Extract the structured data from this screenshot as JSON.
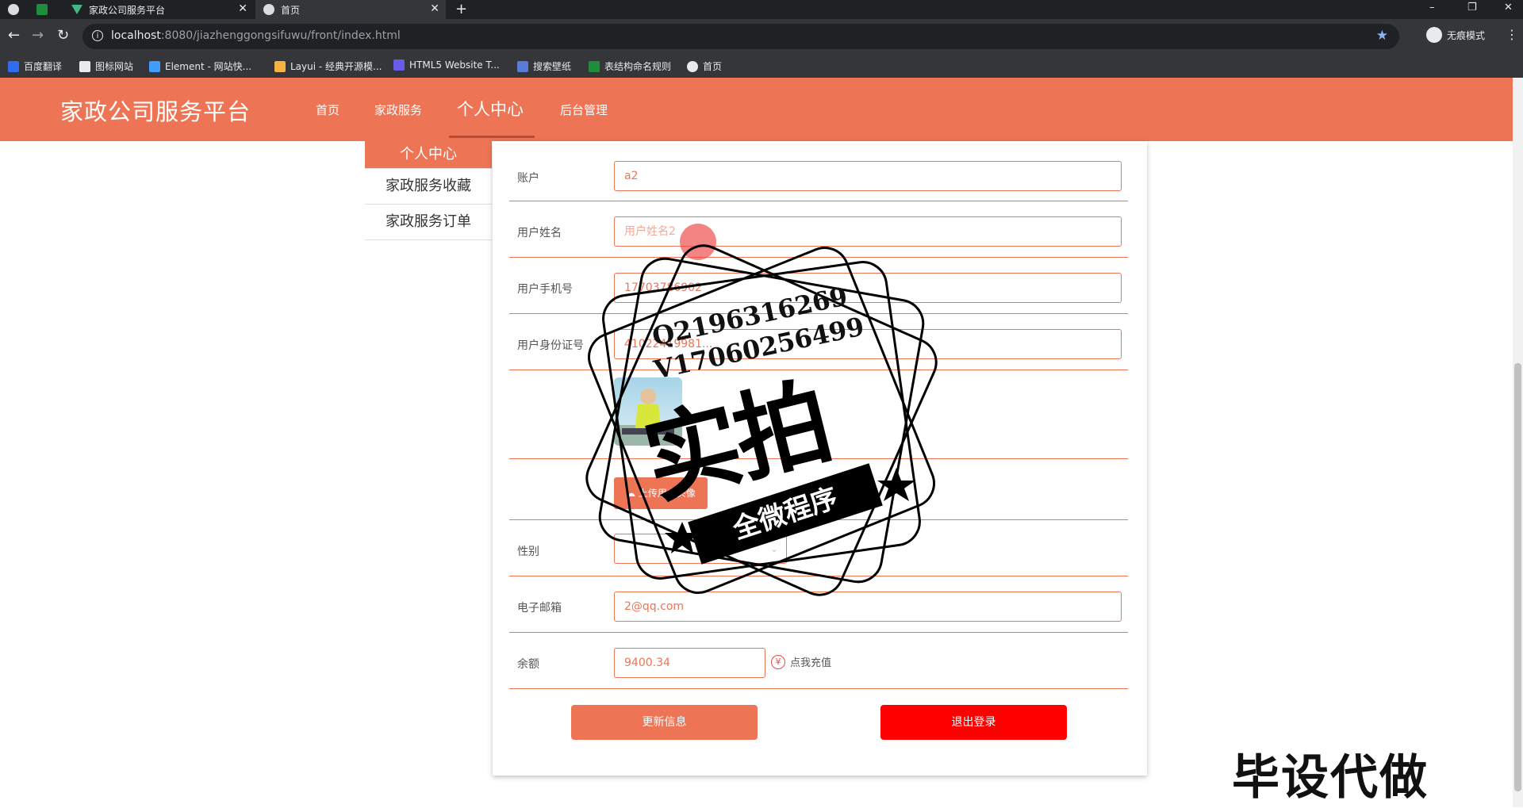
{
  "browser": {
    "tabs": [
      {
        "title": "",
        "icon": "globe-icon"
      },
      {
        "title": "",
        "icon": "sheet-icon"
      },
      {
        "title": "家政公司服务平台",
        "icon": "vue-icon"
      },
      {
        "title": "首页",
        "icon": "globe-icon"
      }
    ],
    "new_tab": "+",
    "window_controls": {
      "minimize": "–",
      "restore": "❐",
      "close": "✕"
    },
    "url_host": "localhost",
    "url_rest": ":8080/jiazhenggongsifuwu/front/index.html",
    "incognito_label": "无痕模式",
    "bookmarks": [
      {
        "label": "百度翻译",
        "color": "#2f6cf0"
      },
      {
        "label": "图标网站",
        "color": "#e8eaed"
      },
      {
        "label": "Element - 网站快...",
        "color": "#409eff"
      },
      {
        "label": "Layui - 经典开源模...",
        "color": "#f5b342"
      },
      {
        "label": "HTML5 Website T...",
        "color": "#6b5ce7"
      },
      {
        "label": "搜索壁纸",
        "color": "#5a7bd6"
      },
      {
        "label": "表结构命名规则",
        "color": "#1e8e3e"
      },
      {
        "label": "首页",
        "color": "#e8eaed"
      }
    ]
  },
  "site": {
    "title": "家政公司服务平台",
    "nav": [
      {
        "label": "首页"
      },
      {
        "label": "家政服务"
      },
      {
        "label": "个人中心"
      },
      {
        "label": "后台管理"
      }
    ],
    "brand_color": "#ee7456"
  },
  "side_menu": [
    {
      "label": "个人中心"
    },
    {
      "label": "家政服务收藏"
    },
    {
      "label": "家政服务订单"
    }
  ],
  "form": {
    "account_label": "账户",
    "account_value": "a2",
    "name_label": "用户姓名",
    "name_placeholder": "用户姓名2",
    "phone_label": "用户手机号",
    "phone_value": "17703786902",
    "idcard_label": "用户身份证号",
    "idcard_value": "41022419981...",
    "upload_button": "上传用户头像",
    "gender_label": "性别",
    "gender_value": "",
    "email_label": "电子邮箱",
    "email_value": "2@qq.com",
    "balance_label": "余额",
    "balance_value": "9400.34",
    "recharge_label": "点我充值",
    "update_button": "更新信息",
    "logout_button": "退出登录"
  },
  "watermark": {
    "line1": "Q2196316269",
    "line2": "V17060256499",
    "big": "实拍",
    "ribbon": "全微程序"
  },
  "corner_text": "毕设代做"
}
